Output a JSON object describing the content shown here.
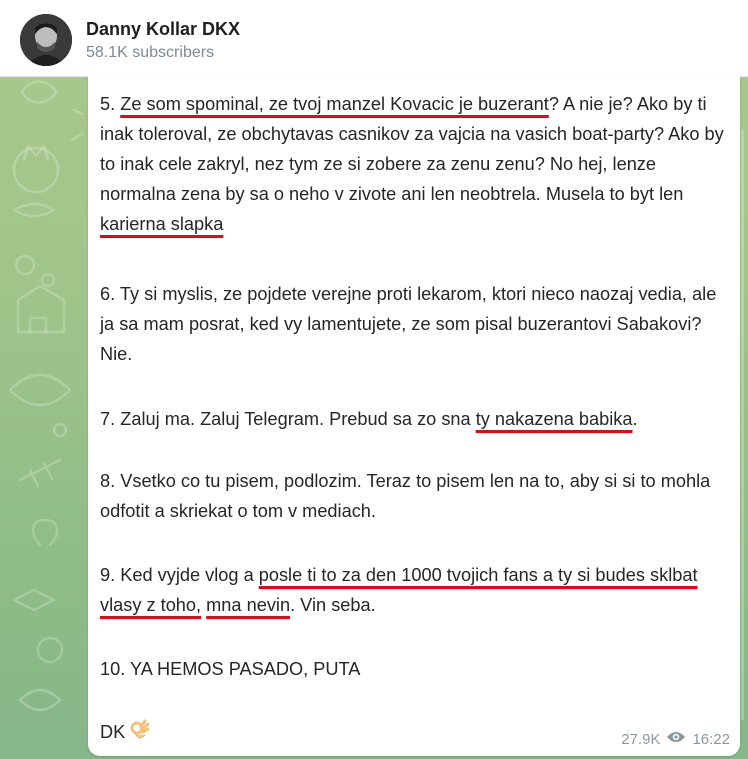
{
  "channel": {
    "name": "Danny Kollar DKX",
    "subscribers": "58.1K subscribers"
  },
  "message": {
    "p5": {
      "num": "5. ",
      "hl1": "Ze som spominal, ze tvoj manzel Kovacic je buzerant",
      "t1": "? A nie je? Ako by ti inak toleroval, ze obchytavas casnikov za vajcia na vasich boat-party? Ako by to inak cele zakryl, nez tym ze si zobere za zenu zenu? No hej, lenze normalna zena by sa o neho v zivote ani len neobtrela. Musela to byt len ",
      "hl2": "karierna slapka"
    },
    "p6": "6. Ty si myslis, ze pojdete verejne proti lekarom, ktori nieco naozaj vedia, ale ja sa mam posrat, ked vy lamentujete, ze som pisal buzerantovi Sabakovi? Nie.",
    "p7": {
      "t1": "7. Zaluj ma. Zaluj Telegram. Prebud sa zo sna ",
      "hl": "ty nakazena babika",
      "t2": "."
    },
    "p8": "8. Vsetko co tu pisem, podlozim. Teraz to pisem len na to, aby si si to mohla odfotit a skriekat o tom v mediach.",
    "p9": {
      "t1": "9. Ked vyjde vlog a ",
      "hl1": "posle ti to za den 1000 tvojich fans a ty si budes sklbat vlasy z toho,",
      "sp": " ",
      "hl2": "mna nevin",
      "t2": ". Vin seba."
    },
    "p10": "10. YA HEMOS PASADO, PUTA",
    "sign": "DK",
    "sign_emoji": "ok-hand-emoji",
    "views": "27.9K",
    "time": "16:22"
  },
  "icons": {
    "views": "eye-icon"
  },
  "colors": {
    "underline": "#d90d1a",
    "meta": "#8b979e"
  }
}
